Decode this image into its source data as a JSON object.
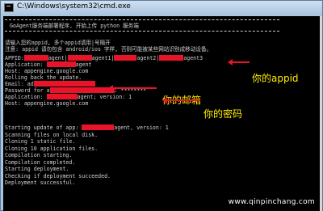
{
  "window": {
    "title": "C:\\Windows\\system32\\cmd.exe"
  },
  "header": {
    "banner": "GoAgent服务端部署程序, 开始上传 python 服务端"
  },
  "prompt": {
    "line1": "请输入您的appid, 多个appid请用|号隔开",
    "line2": "注意: appid 请勿包含 android/ios 字样, 否则可能被某些网站识别成移动设备。"
  },
  "session": {
    "appid_prefix": "APPID:",
    "appid_s1": "agent|",
    "appid_s2": "agent1|",
    "appid_s3": "agent2|",
    "appid_s4": "agent3",
    "app1_prefix": "Application: ",
    "app1_suffix": "agent",
    "host1": "Host: appengine.google.com",
    "rolling": "Rolling back the update.",
    "email_prefix": "Email: ad",
    "password_prefix": "Password for a",
    "password_mask": ": ********",
    "app2_prefix": "Application: ",
    "app2_suffix": "agent; version: 1",
    "host2": "Host: appengine.google.com"
  },
  "log": {
    "starting_prefix": "Starting update of app: ",
    "starting_suffix": "agent, version: 1",
    "lines": [
      "Scanning files on local disk.",
      "Cloning 1 static file.",
      "Cloning 10 application files.",
      "Compilation starting.",
      "Compilation completed.",
      "Starting deployment.",
      "Checking if deployment succeeded.",
      "Deployment successful."
    ]
  },
  "annotations": {
    "appid_note": "你的appid",
    "email_note": "你的邮箱",
    "password_note": "你的密码",
    "color": "#e8152a",
    "note_color": "#ffee00"
  },
  "watermark": "www.qinpinchang.com"
}
